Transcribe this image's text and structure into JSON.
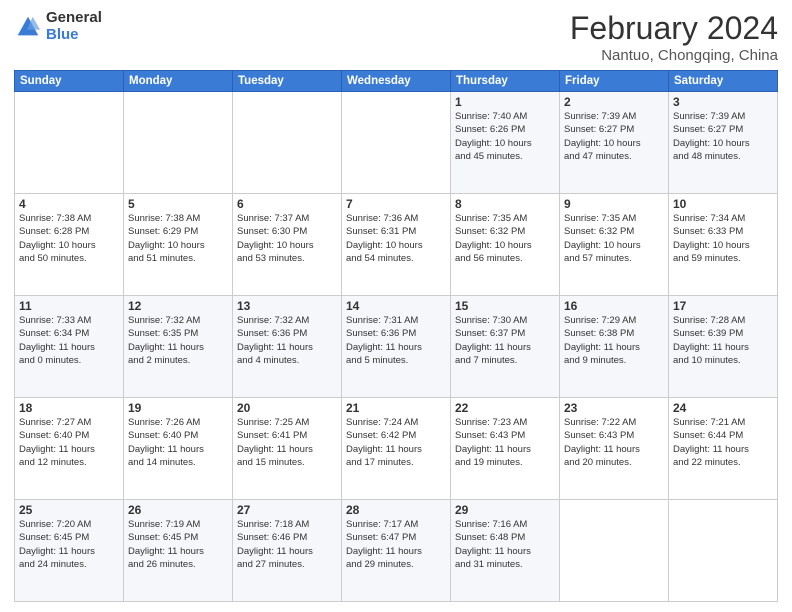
{
  "logo": {
    "general": "General",
    "blue": "Blue"
  },
  "title": "February 2024",
  "location": "Nantuo, Chongqing, China",
  "days_header": [
    "Sunday",
    "Monday",
    "Tuesday",
    "Wednesday",
    "Thursday",
    "Friday",
    "Saturday"
  ],
  "weeks": [
    [
      {
        "day": "",
        "info": ""
      },
      {
        "day": "",
        "info": ""
      },
      {
        "day": "",
        "info": ""
      },
      {
        "day": "",
        "info": ""
      },
      {
        "day": "1",
        "info": "Sunrise: 7:40 AM\nSunset: 6:26 PM\nDaylight: 10 hours\nand 45 minutes."
      },
      {
        "day": "2",
        "info": "Sunrise: 7:39 AM\nSunset: 6:27 PM\nDaylight: 10 hours\nand 47 minutes."
      },
      {
        "day": "3",
        "info": "Sunrise: 7:39 AM\nSunset: 6:27 PM\nDaylight: 10 hours\nand 48 minutes."
      }
    ],
    [
      {
        "day": "4",
        "info": "Sunrise: 7:38 AM\nSunset: 6:28 PM\nDaylight: 10 hours\nand 50 minutes."
      },
      {
        "day": "5",
        "info": "Sunrise: 7:38 AM\nSunset: 6:29 PM\nDaylight: 10 hours\nand 51 minutes."
      },
      {
        "day": "6",
        "info": "Sunrise: 7:37 AM\nSunset: 6:30 PM\nDaylight: 10 hours\nand 53 minutes."
      },
      {
        "day": "7",
        "info": "Sunrise: 7:36 AM\nSunset: 6:31 PM\nDaylight: 10 hours\nand 54 minutes."
      },
      {
        "day": "8",
        "info": "Sunrise: 7:35 AM\nSunset: 6:32 PM\nDaylight: 10 hours\nand 56 minutes."
      },
      {
        "day": "9",
        "info": "Sunrise: 7:35 AM\nSunset: 6:32 PM\nDaylight: 10 hours\nand 57 minutes."
      },
      {
        "day": "10",
        "info": "Sunrise: 7:34 AM\nSunset: 6:33 PM\nDaylight: 10 hours\nand 59 minutes."
      }
    ],
    [
      {
        "day": "11",
        "info": "Sunrise: 7:33 AM\nSunset: 6:34 PM\nDaylight: 11 hours\nand 0 minutes."
      },
      {
        "day": "12",
        "info": "Sunrise: 7:32 AM\nSunset: 6:35 PM\nDaylight: 11 hours\nand 2 minutes."
      },
      {
        "day": "13",
        "info": "Sunrise: 7:32 AM\nSunset: 6:36 PM\nDaylight: 11 hours\nand 4 minutes."
      },
      {
        "day": "14",
        "info": "Sunrise: 7:31 AM\nSunset: 6:36 PM\nDaylight: 11 hours\nand 5 minutes."
      },
      {
        "day": "15",
        "info": "Sunrise: 7:30 AM\nSunset: 6:37 PM\nDaylight: 11 hours\nand 7 minutes."
      },
      {
        "day": "16",
        "info": "Sunrise: 7:29 AM\nSunset: 6:38 PM\nDaylight: 11 hours\nand 9 minutes."
      },
      {
        "day": "17",
        "info": "Sunrise: 7:28 AM\nSunset: 6:39 PM\nDaylight: 11 hours\nand 10 minutes."
      }
    ],
    [
      {
        "day": "18",
        "info": "Sunrise: 7:27 AM\nSunset: 6:40 PM\nDaylight: 11 hours\nand 12 minutes."
      },
      {
        "day": "19",
        "info": "Sunrise: 7:26 AM\nSunset: 6:40 PM\nDaylight: 11 hours\nand 14 minutes."
      },
      {
        "day": "20",
        "info": "Sunrise: 7:25 AM\nSunset: 6:41 PM\nDaylight: 11 hours\nand 15 minutes."
      },
      {
        "day": "21",
        "info": "Sunrise: 7:24 AM\nSunset: 6:42 PM\nDaylight: 11 hours\nand 17 minutes."
      },
      {
        "day": "22",
        "info": "Sunrise: 7:23 AM\nSunset: 6:43 PM\nDaylight: 11 hours\nand 19 minutes."
      },
      {
        "day": "23",
        "info": "Sunrise: 7:22 AM\nSunset: 6:43 PM\nDaylight: 11 hours\nand 20 minutes."
      },
      {
        "day": "24",
        "info": "Sunrise: 7:21 AM\nSunset: 6:44 PM\nDaylight: 11 hours\nand 22 minutes."
      }
    ],
    [
      {
        "day": "25",
        "info": "Sunrise: 7:20 AM\nSunset: 6:45 PM\nDaylight: 11 hours\nand 24 minutes."
      },
      {
        "day": "26",
        "info": "Sunrise: 7:19 AM\nSunset: 6:45 PM\nDaylight: 11 hours\nand 26 minutes."
      },
      {
        "day": "27",
        "info": "Sunrise: 7:18 AM\nSunset: 6:46 PM\nDaylight: 11 hours\nand 27 minutes."
      },
      {
        "day": "28",
        "info": "Sunrise: 7:17 AM\nSunset: 6:47 PM\nDaylight: 11 hours\nand 29 minutes."
      },
      {
        "day": "29",
        "info": "Sunrise: 7:16 AM\nSunset: 6:48 PM\nDaylight: 11 hours\nand 31 minutes."
      },
      {
        "day": "",
        "info": ""
      },
      {
        "day": "",
        "info": ""
      }
    ]
  ]
}
